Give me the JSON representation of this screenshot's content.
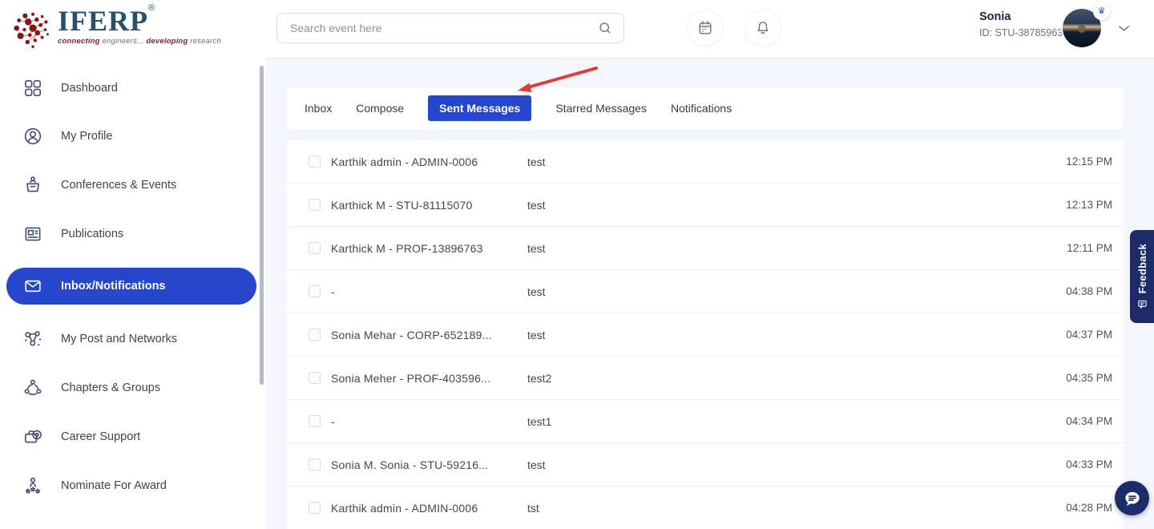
{
  "brand": {
    "name": "IFERP",
    "registered": "®",
    "tagline": {
      "w1": "connecting",
      "w2": " engineers...",
      "w3": " developing",
      "w4": " research"
    }
  },
  "topbar": {
    "search_placeholder": "Search event here",
    "user": {
      "name": "Sonia",
      "id": "ID: STU-38785963",
      "badge_icon": "crown-icon",
      "badge_glyph": "♛"
    }
  },
  "sidebar": {
    "items": [
      {
        "label": "Dashboard",
        "icon": "grid-icon",
        "active": false
      },
      {
        "label": "My Profile",
        "icon": "profile-icon",
        "active": false
      },
      {
        "label": "Conferences & Events",
        "icon": "conference-icon",
        "active": false
      },
      {
        "label": "Publications",
        "icon": "publications-icon",
        "active": false
      },
      {
        "label": "Inbox/Notifications",
        "icon": "inbox-icon",
        "active": true
      },
      {
        "label": "My Post and Networks",
        "icon": "network-icon",
        "active": false
      },
      {
        "label": "Chapters & Groups",
        "icon": "groups-icon",
        "active": false
      },
      {
        "label": "Career Support",
        "icon": "career-icon",
        "active": false
      },
      {
        "label": "Nominate For Award",
        "icon": "award-icon",
        "active": false
      }
    ]
  },
  "tabs": [
    {
      "label": "Inbox",
      "active": false
    },
    {
      "label": "Compose",
      "active": false
    },
    {
      "label": "Sent Messages",
      "active": true
    },
    {
      "label": "Starred Messages",
      "active": false
    },
    {
      "label": "Notifications",
      "active": false
    }
  ],
  "messages": [
    {
      "sender": "Karthik admin - ADMIN-0006",
      "subject": "test",
      "time": "12:15 PM"
    },
    {
      "sender": "Karthick M - STU-81115070",
      "subject": "test",
      "time": "12:13 PM"
    },
    {
      "sender": "Karthick M - PROF-13896763",
      "subject": "test",
      "time": "12:11 PM"
    },
    {
      "sender": "-",
      "subject": "test",
      "time": "04:38 PM"
    },
    {
      "sender": "Sonia Mehar - CORP-652189...",
      "subject": "test",
      "time": "04:37 PM"
    },
    {
      "sender": "Sonia Meher - PROF-403596...",
      "subject": "test2",
      "time": "04:35 PM"
    },
    {
      "sender": "-",
      "subject": "test1",
      "time": "04:34 PM"
    },
    {
      "sender": "Sonia M. Sonia - STU-59216...",
      "subject": "test",
      "time": "04:33 PM"
    },
    {
      "sender": "Karthik admin - ADMIN-0006",
      "subject": "tst",
      "time": "04:28 PM"
    }
  ],
  "feedback": {
    "label": "Feedback"
  },
  "colors": {
    "accent_blue": "#2646cb",
    "navy": "#1b2c68",
    "logo_maroon": "#8c1d1d",
    "arrow_red": "#e53935",
    "main_bg": "#f4f6fb"
  }
}
